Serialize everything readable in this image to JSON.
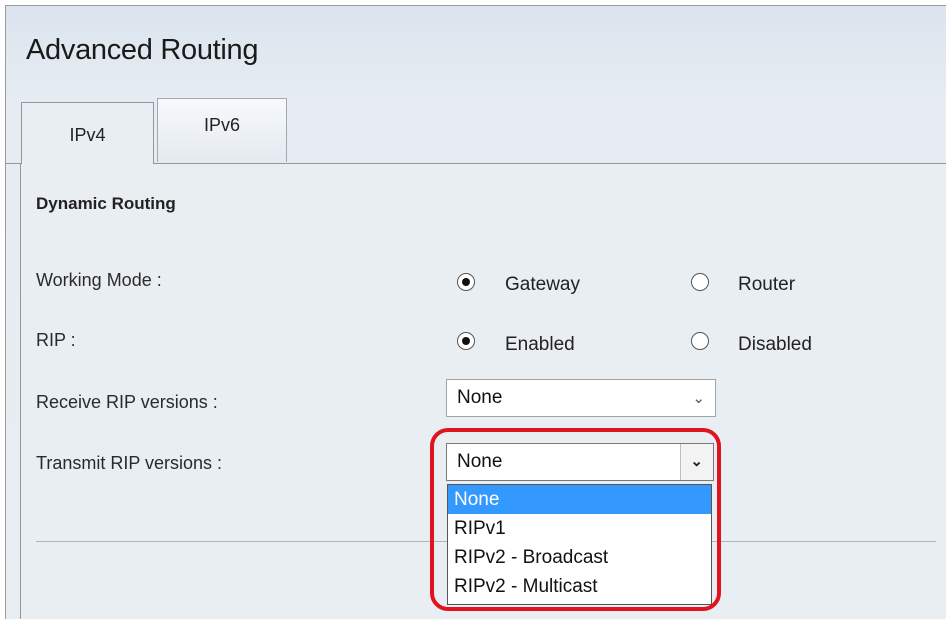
{
  "page": {
    "title": "Advanced Routing"
  },
  "tabs": [
    {
      "label": "IPv4",
      "active": true
    },
    {
      "label": "IPv6",
      "active": false
    }
  ],
  "section": {
    "title": "Dynamic Routing"
  },
  "working_mode": {
    "label": "Working Mode :",
    "options": [
      {
        "label": "Gateway",
        "checked": true
      },
      {
        "label": "Router",
        "checked": false
      }
    ]
  },
  "rip": {
    "label": "RIP :",
    "options": [
      {
        "label": "Enabled",
        "checked": true
      },
      {
        "label": "Disabled",
        "checked": false
      }
    ]
  },
  "receive_rip": {
    "label": "Receive RIP versions :",
    "value": "None"
  },
  "transmit_rip": {
    "label": "Transmit RIP versions :",
    "value": "None",
    "options": [
      "None",
      "RIPv1",
      "RIPv2 - Broadcast",
      "RIPv2 - Multicast"
    ],
    "highlighted_option": "None"
  },
  "icons": {
    "dropdown_arrow": "chevron-down-icon"
  },
  "colors": {
    "highlight_ring": "#e0141e",
    "selected_option": "#3399ff"
  }
}
